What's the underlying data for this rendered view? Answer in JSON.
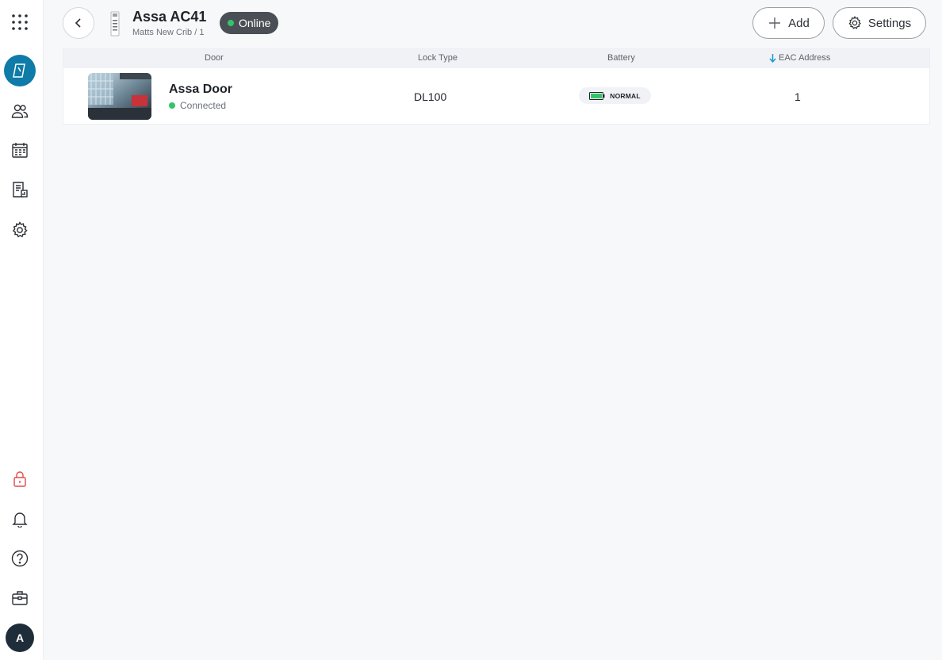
{
  "sidebar": {
    "items": [
      {
        "name": "apps-grid-icon"
      },
      {
        "name": "credential-card-icon",
        "active": true
      },
      {
        "name": "users-icon"
      },
      {
        "name": "schedule-calendar-icon"
      },
      {
        "name": "reports-icon"
      },
      {
        "name": "settings-gear-icon"
      },
      {
        "name": "lock-icon"
      },
      {
        "name": "notification-bell-icon"
      },
      {
        "name": "help-icon"
      },
      {
        "name": "toolbox-icon"
      }
    ],
    "avatar_initial": "A",
    "accent_color": "#0e7ba8",
    "lock_color": "#e04b4b"
  },
  "header": {
    "title": "Assa AC41",
    "subtitle": "Matts New Crib / 1",
    "status": "Online",
    "add_label": "Add",
    "settings_label": "Settings"
  },
  "table": {
    "columns": {
      "door": "Door",
      "lock_type": "Lock Type",
      "battery": "Battery",
      "eac_address": "EAC Address"
    },
    "rows": [
      {
        "door_name": "Assa Door",
        "door_status": "Connected",
        "lock_type": "DL100",
        "battery": "NORMAL",
        "eac_address": "1"
      }
    ]
  },
  "colors": {
    "status_green": "#33c46a",
    "sort_arrow": "#1a9ad6"
  }
}
